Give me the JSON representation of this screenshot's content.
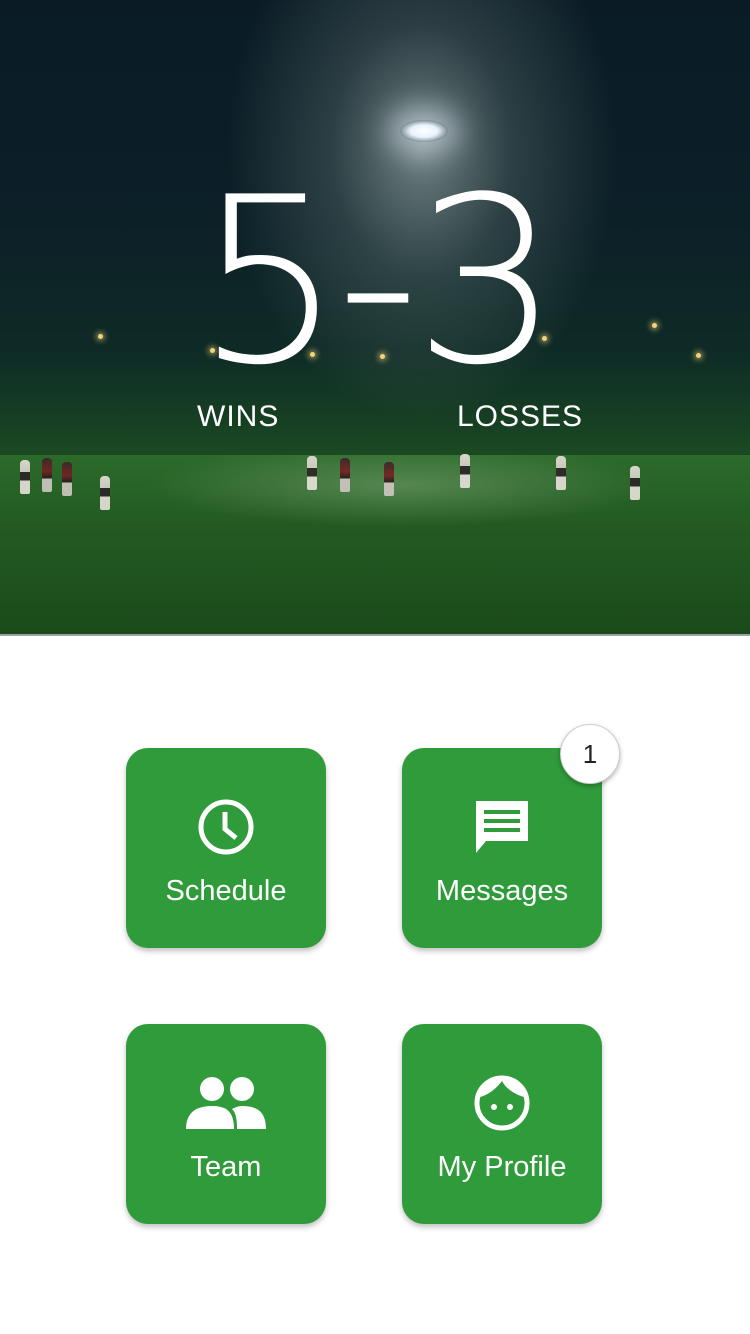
{
  "record": {
    "score": "5-3",
    "wins_label": "WINS",
    "losses_label": "LOSSES"
  },
  "tiles": [
    {
      "label": "Schedule",
      "icon": "clock-icon"
    },
    {
      "label": "Messages",
      "icon": "message-icon"
    },
    {
      "label": "Team",
      "icon": "people-icon"
    },
    {
      "label": "My Profile",
      "icon": "face-icon"
    }
  ],
  "messages_badge": "1",
  "colors": {
    "tile": "#2f9b3a",
    "badge_bg": "#ffffff",
    "text": "#ffffff"
  }
}
